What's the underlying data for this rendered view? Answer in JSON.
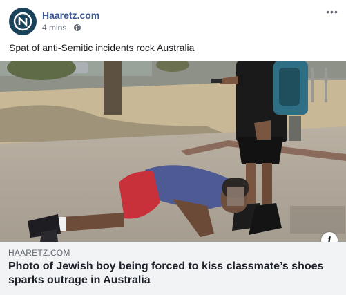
{
  "post": {
    "page_name": "Haaretz.com",
    "timestamp": "4 mins",
    "separator": "·",
    "privacy_icon": "globe-icon",
    "more_icon": "ellipsis-icon",
    "more_label": "•••",
    "text": "Spat of anti-Semitic incidents rock Australia"
  },
  "link_preview": {
    "domain": "HAARETZ.COM",
    "headline": "Photo of Jewish boy being forced to kiss classmate’s shoes sparks outrage in Australia",
    "info_icon": "info-icon",
    "info_label": "i"
  },
  "colors": {
    "page_name": "#385898",
    "avatar_bg": "#1a4259",
    "link_box_bg": "#f2f3f5",
    "muted_text": "#606770"
  }
}
